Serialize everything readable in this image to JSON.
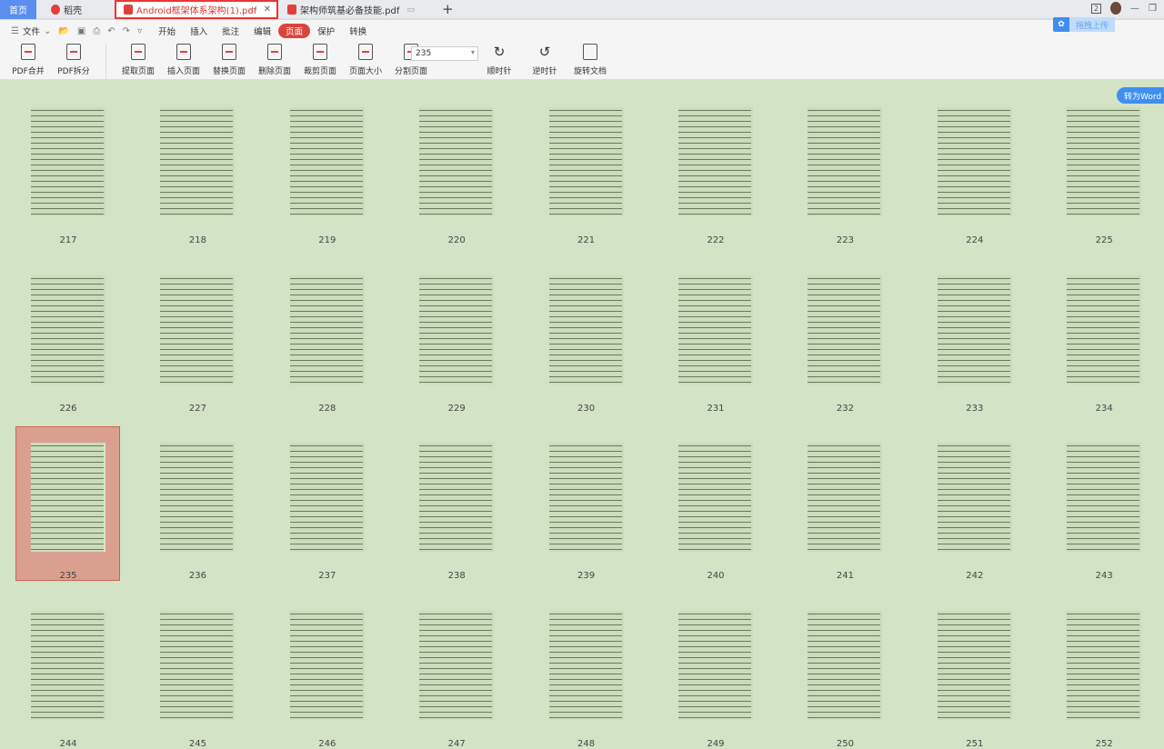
{
  "tabs": {
    "home": "首页",
    "daoke": "稻壳",
    "active": "Android框架体系架构(1).pdf",
    "second": "架构师筑基必备技能.pdf",
    "new": "+"
  },
  "window": {
    "badge": "2"
  },
  "menu": {
    "file": "文件",
    "items": [
      "开始",
      "插入",
      "批注",
      "编辑",
      "页面",
      "保护",
      "转换"
    ],
    "active_index": 4
  },
  "tools": [
    {
      "label": "PDF合并",
      "icon": "merge-icon"
    },
    {
      "label": "PDF拆分",
      "icon": "split-icon"
    },
    {
      "label": "提取页面",
      "icon": "extract-icon"
    },
    {
      "label": "插入页面",
      "icon": "insert-page-icon"
    },
    {
      "label": "替换页面",
      "icon": "replace-icon"
    },
    {
      "label": "删除页面",
      "icon": "delete-page-icon"
    },
    {
      "label": "裁剪页面",
      "icon": "crop-icon"
    },
    {
      "label": "页面大小",
      "icon": "page-size-icon"
    },
    {
      "label": "分割页面",
      "icon": "divide-icon"
    }
  ],
  "page_input": "235",
  "rotate": {
    "cw": "顺时针",
    "ccw": "逆时针",
    "rotate_doc": "旋转文档"
  },
  "upload": "拖拽上传",
  "to_word": "转为Word",
  "pages": [
    217,
    218,
    219,
    220,
    221,
    222,
    223,
    224,
    225,
    226,
    227,
    228,
    229,
    230,
    231,
    232,
    233,
    234,
    235,
    236,
    237,
    238,
    239,
    240,
    241,
    242,
    243,
    244,
    245,
    246,
    247,
    248,
    249,
    250,
    251,
    252
  ],
  "selected_page": 235
}
